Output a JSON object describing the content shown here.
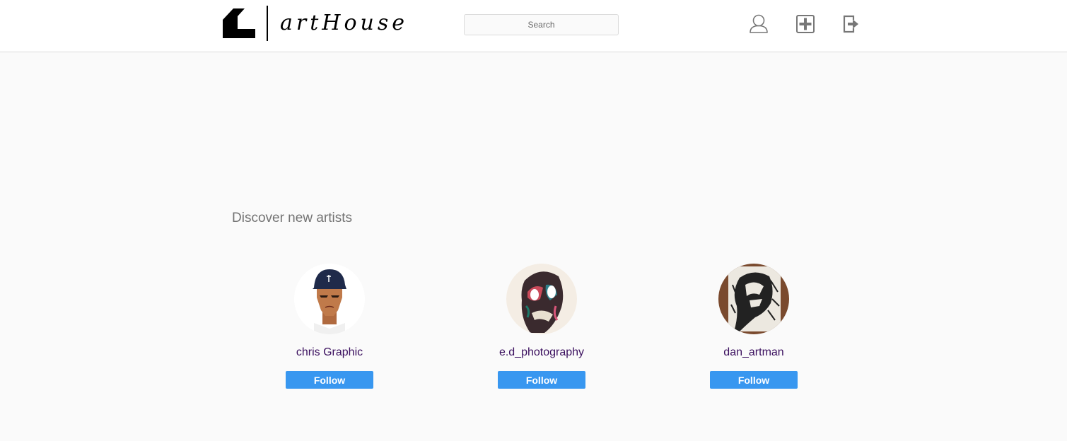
{
  "brand": {
    "name": "artHouse",
    "logo_icon": "house-logo-icon"
  },
  "search": {
    "placeholder": "Search"
  },
  "nav": {
    "profile_icon": "user-icon",
    "add_icon": "plus-square-icon",
    "logout_icon": "logout-icon"
  },
  "discover": {
    "title": "Discover new artists",
    "artists": [
      {
        "name": "chris Graphic",
        "follow_label": "Follow"
      },
      {
        "name": "e.d_photography",
        "follow_label": "Follow"
      },
      {
        "name": "dan_artman",
        "follow_label": "Follow"
      }
    ]
  },
  "colors": {
    "accent": "#3897f0",
    "username": "#3a0f5e",
    "heading": "#737373",
    "background": "#fafafa"
  }
}
